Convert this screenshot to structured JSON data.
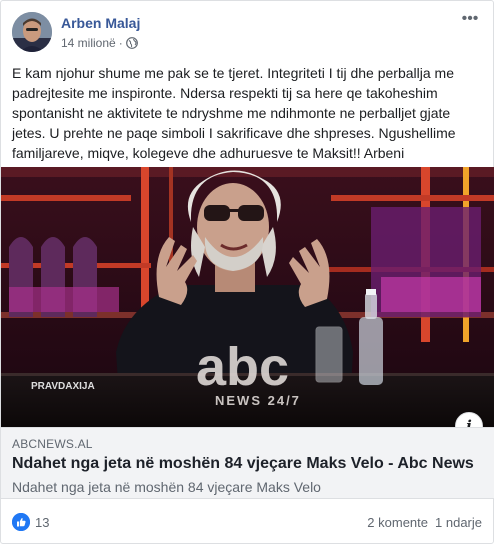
{
  "post": {
    "author": "Arben Malaj",
    "timestamp": "14 milionë",
    "privacy_icon": "globe-icon",
    "text": "E kam njohur shume me pak se te tjeret. Integriteti I tij dhe perballja me padrejtesite me inspironte. Ndersa respekti tij sa here qe takoheshim spontanisht ne aktivitete te ndryshme me ndihmonte ne perballjet gjate jetes. U prehte ne paqe simboli I sakrificave dhe shpreses. Ngushellime familjareve, miqve, kolegeve dhe adhuruesve te Maksit!! Arbeni"
  },
  "media": {
    "logo_text": "abc",
    "logo_sub": "NEWS 24/7",
    "overlay_text": "PRAVDAXIJA"
  },
  "link": {
    "domain": "ABCNEWS.AL",
    "title": "Ndahet nga jeta në moshën 84 vjeçare Maks Velo - Abc News",
    "description": "Ndahet nga jeta në moshën 84 vjeçare Maks Velo"
  },
  "footer": {
    "likes": "13",
    "comments": "2 komente",
    "shares": "1 ndarje"
  },
  "colors": {
    "author": "#385898",
    "like": "#2078f4",
    "link_bg": "#f2f3f5"
  }
}
